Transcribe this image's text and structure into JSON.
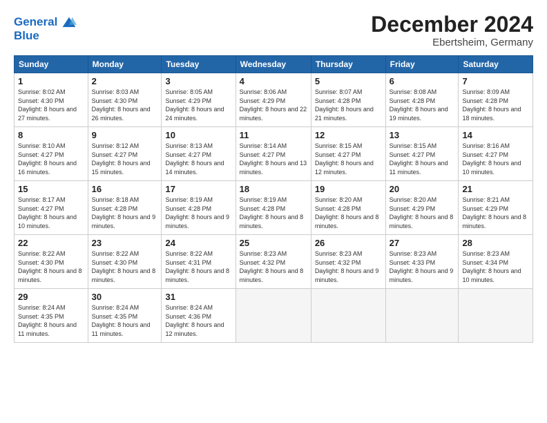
{
  "logo": {
    "line1": "General",
    "line2": "Blue"
  },
  "title": "December 2024",
  "subtitle": "Ebertsheim, Germany",
  "headers": [
    "Sunday",
    "Monday",
    "Tuesday",
    "Wednesday",
    "Thursday",
    "Friday",
    "Saturday"
  ],
  "weeks": [
    [
      {
        "day": "1",
        "info": "Sunrise: 8:02 AM\nSunset: 4:30 PM\nDaylight: 8 hours and 27 minutes."
      },
      {
        "day": "2",
        "info": "Sunrise: 8:03 AM\nSunset: 4:30 PM\nDaylight: 8 hours and 26 minutes."
      },
      {
        "day": "3",
        "info": "Sunrise: 8:05 AM\nSunset: 4:29 PM\nDaylight: 8 hours and 24 minutes."
      },
      {
        "day": "4",
        "info": "Sunrise: 8:06 AM\nSunset: 4:29 PM\nDaylight: 8 hours and 22 minutes."
      },
      {
        "day": "5",
        "info": "Sunrise: 8:07 AM\nSunset: 4:28 PM\nDaylight: 8 hours and 21 minutes."
      },
      {
        "day": "6",
        "info": "Sunrise: 8:08 AM\nSunset: 4:28 PM\nDaylight: 8 hours and 19 minutes."
      },
      {
        "day": "7",
        "info": "Sunrise: 8:09 AM\nSunset: 4:28 PM\nDaylight: 8 hours and 18 minutes."
      }
    ],
    [
      {
        "day": "8",
        "info": "Sunrise: 8:10 AM\nSunset: 4:27 PM\nDaylight: 8 hours and 16 minutes."
      },
      {
        "day": "9",
        "info": "Sunrise: 8:12 AM\nSunset: 4:27 PM\nDaylight: 8 hours and 15 minutes."
      },
      {
        "day": "10",
        "info": "Sunrise: 8:13 AM\nSunset: 4:27 PM\nDaylight: 8 hours and 14 minutes."
      },
      {
        "day": "11",
        "info": "Sunrise: 8:14 AM\nSunset: 4:27 PM\nDaylight: 8 hours and 13 minutes."
      },
      {
        "day": "12",
        "info": "Sunrise: 8:15 AM\nSunset: 4:27 PM\nDaylight: 8 hours and 12 minutes."
      },
      {
        "day": "13",
        "info": "Sunrise: 8:15 AM\nSunset: 4:27 PM\nDaylight: 8 hours and 11 minutes."
      },
      {
        "day": "14",
        "info": "Sunrise: 8:16 AM\nSunset: 4:27 PM\nDaylight: 8 hours and 10 minutes."
      }
    ],
    [
      {
        "day": "15",
        "info": "Sunrise: 8:17 AM\nSunset: 4:27 PM\nDaylight: 8 hours and 10 minutes."
      },
      {
        "day": "16",
        "info": "Sunrise: 8:18 AM\nSunset: 4:28 PM\nDaylight: 8 hours and 9 minutes."
      },
      {
        "day": "17",
        "info": "Sunrise: 8:19 AM\nSunset: 4:28 PM\nDaylight: 8 hours and 9 minutes."
      },
      {
        "day": "18",
        "info": "Sunrise: 8:19 AM\nSunset: 4:28 PM\nDaylight: 8 hours and 8 minutes."
      },
      {
        "day": "19",
        "info": "Sunrise: 8:20 AM\nSunset: 4:28 PM\nDaylight: 8 hours and 8 minutes."
      },
      {
        "day": "20",
        "info": "Sunrise: 8:20 AM\nSunset: 4:29 PM\nDaylight: 8 hours and 8 minutes."
      },
      {
        "day": "21",
        "info": "Sunrise: 8:21 AM\nSunset: 4:29 PM\nDaylight: 8 hours and 8 minutes."
      }
    ],
    [
      {
        "day": "22",
        "info": "Sunrise: 8:22 AM\nSunset: 4:30 PM\nDaylight: 8 hours and 8 minutes."
      },
      {
        "day": "23",
        "info": "Sunrise: 8:22 AM\nSunset: 4:30 PM\nDaylight: 8 hours and 8 minutes."
      },
      {
        "day": "24",
        "info": "Sunrise: 8:22 AM\nSunset: 4:31 PM\nDaylight: 8 hours and 8 minutes."
      },
      {
        "day": "25",
        "info": "Sunrise: 8:23 AM\nSunset: 4:32 PM\nDaylight: 8 hours and 8 minutes."
      },
      {
        "day": "26",
        "info": "Sunrise: 8:23 AM\nSunset: 4:32 PM\nDaylight: 8 hours and 9 minutes."
      },
      {
        "day": "27",
        "info": "Sunrise: 8:23 AM\nSunset: 4:33 PM\nDaylight: 8 hours and 9 minutes."
      },
      {
        "day": "28",
        "info": "Sunrise: 8:23 AM\nSunset: 4:34 PM\nDaylight: 8 hours and 10 minutes."
      }
    ],
    [
      {
        "day": "29",
        "info": "Sunrise: 8:24 AM\nSunset: 4:35 PM\nDaylight: 8 hours and 11 minutes."
      },
      {
        "day": "30",
        "info": "Sunrise: 8:24 AM\nSunset: 4:35 PM\nDaylight: 8 hours and 11 minutes."
      },
      {
        "day": "31",
        "info": "Sunrise: 8:24 AM\nSunset: 4:36 PM\nDaylight: 8 hours and 12 minutes."
      },
      null,
      null,
      null,
      null
    ]
  ]
}
